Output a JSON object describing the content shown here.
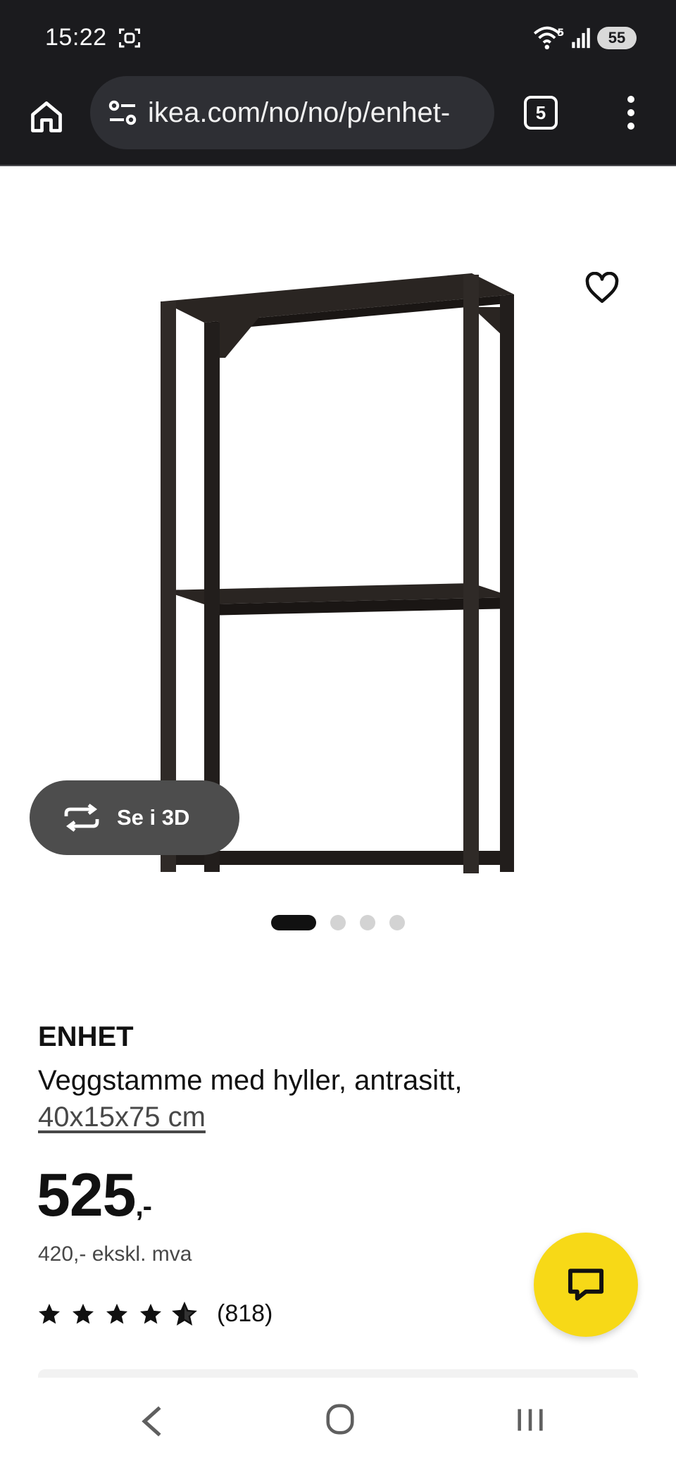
{
  "status_bar": {
    "time": "15:22",
    "battery": "55",
    "wifi_label": "5"
  },
  "browser": {
    "url": "ikea.com/no/no/p/enhet-",
    "tab_count": "5"
  },
  "product": {
    "carousel": {
      "active_index": 0,
      "count": 4
    },
    "view_3d_label": "Se i 3D",
    "name": "ENHET",
    "description": "Veggstamme med hyller, antrasitt,",
    "size": "40x15x75 cm",
    "price_main": "525",
    "price_suffix": ",-",
    "price_ex_vat": "420,- ekskl. mva",
    "rating_stars": 4.5,
    "rating_count": "(818)"
  },
  "colors": {
    "brand_yellow": "#f7d917",
    "browser_dark": "#1b1b1e",
    "shelf_color": "#2a2522"
  },
  "icons": {
    "home": "home-icon",
    "tune": "site-settings-icon",
    "more": "more-vert-icon",
    "favorite": "heart-outline-icon",
    "view_3d": "rotate-3d-icon",
    "chat": "chat-bubble-icon",
    "star": "star-icon"
  }
}
